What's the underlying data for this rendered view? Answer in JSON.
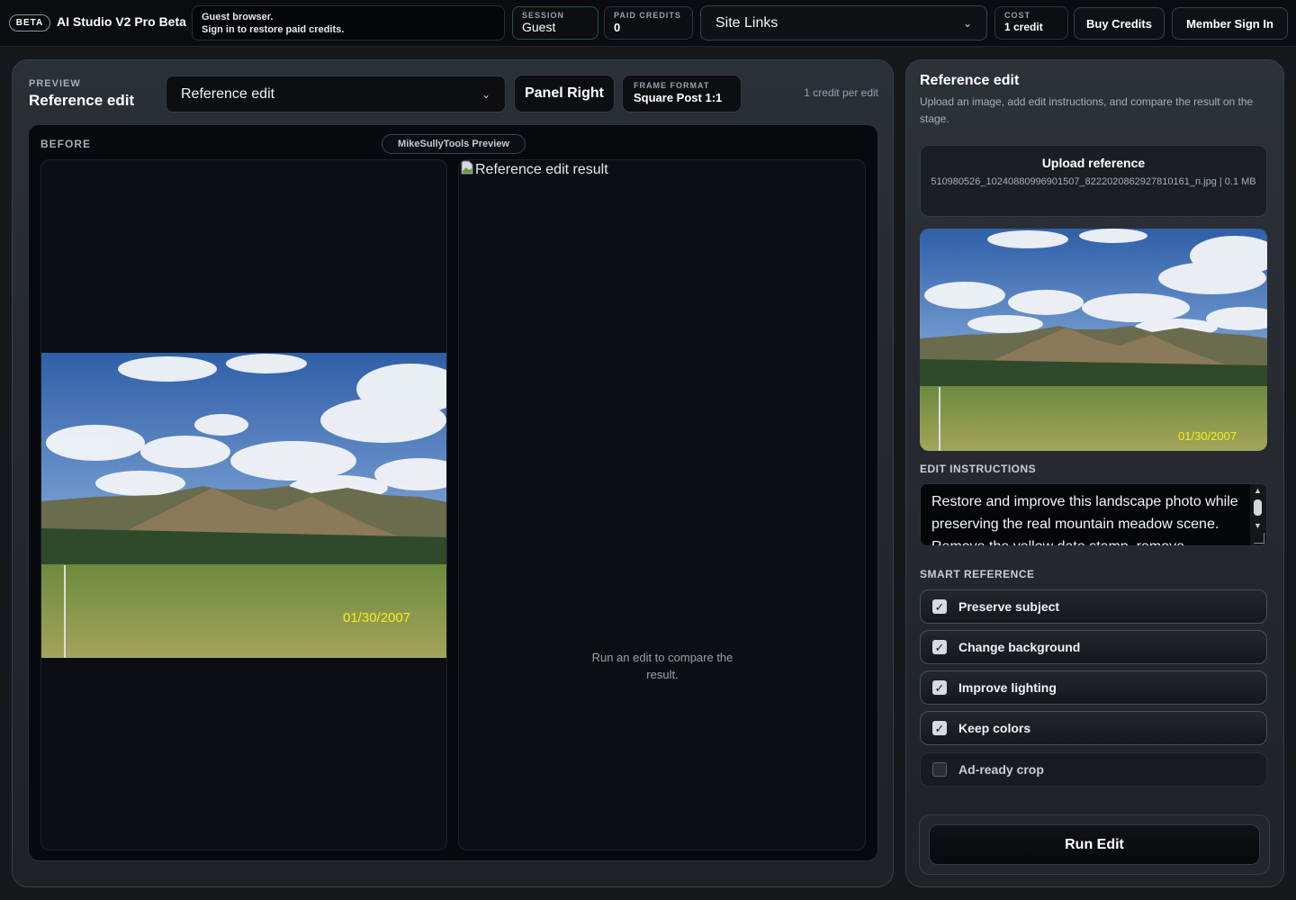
{
  "topbar": {
    "beta_badge": "BETA",
    "app_title": "AI Studio V2 Pro Beta",
    "guest_line1": "Guest browser.",
    "guest_line2": "Sign in to restore paid credits.",
    "session_label": "SESSION",
    "session_value": "Guest",
    "credits_label": "PAID CREDITS",
    "credits_value": "0",
    "site_links": "Site Links",
    "cost_label": "COST",
    "cost_value": "1 credit",
    "buy_credits": "Buy Credits",
    "member_sign_in": "Member Sign In"
  },
  "preview": {
    "label": "PREVIEW",
    "title": "Reference edit",
    "mode_select": "Reference edit",
    "panel_button": "Panel Right",
    "frame_format_label": "FRAME FORMAT",
    "frame_format_value": "Square Post 1:1",
    "credit_note": "1 credit per edit",
    "before_label": "BEFORE",
    "watermark": "MikeSullyTools Preview",
    "result_alt": "Reference edit result",
    "after_empty": "Run an edit to compare the result.",
    "photo_date": "01/30/2007"
  },
  "sidebar": {
    "title": "Reference edit",
    "description": "Upload an image, add edit instructions, and compare the result on the stage.",
    "upload_title": "Upload reference",
    "upload_file": "510980526_10240880996901507_8222020862927810161_n.jpg | 0.1 MB",
    "photo_date": "01/30/2007",
    "instructions_label": "EDIT INSTRUCTIONS",
    "instructions_text": "Restore and improve this landscape photo while preserving the real mountain meadow scene. Remove the yellow date stamp, remove",
    "smart_reference_label": "SMART REFERENCE",
    "options": [
      {
        "label": "Preserve subject",
        "checked": true
      },
      {
        "label": "Change background",
        "checked": true
      },
      {
        "label": "Improve lighting",
        "checked": true
      },
      {
        "label": "Keep colors",
        "checked": true
      },
      {
        "label": "Ad-ready crop",
        "checked": false
      }
    ],
    "run_button": "Run Edit"
  },
  "icons": {
    "checkmark": "checkmark-icon",
    "dropdown": "chevron-down-icon",
    "broken_image": "broken-image-icon"
  }
}
